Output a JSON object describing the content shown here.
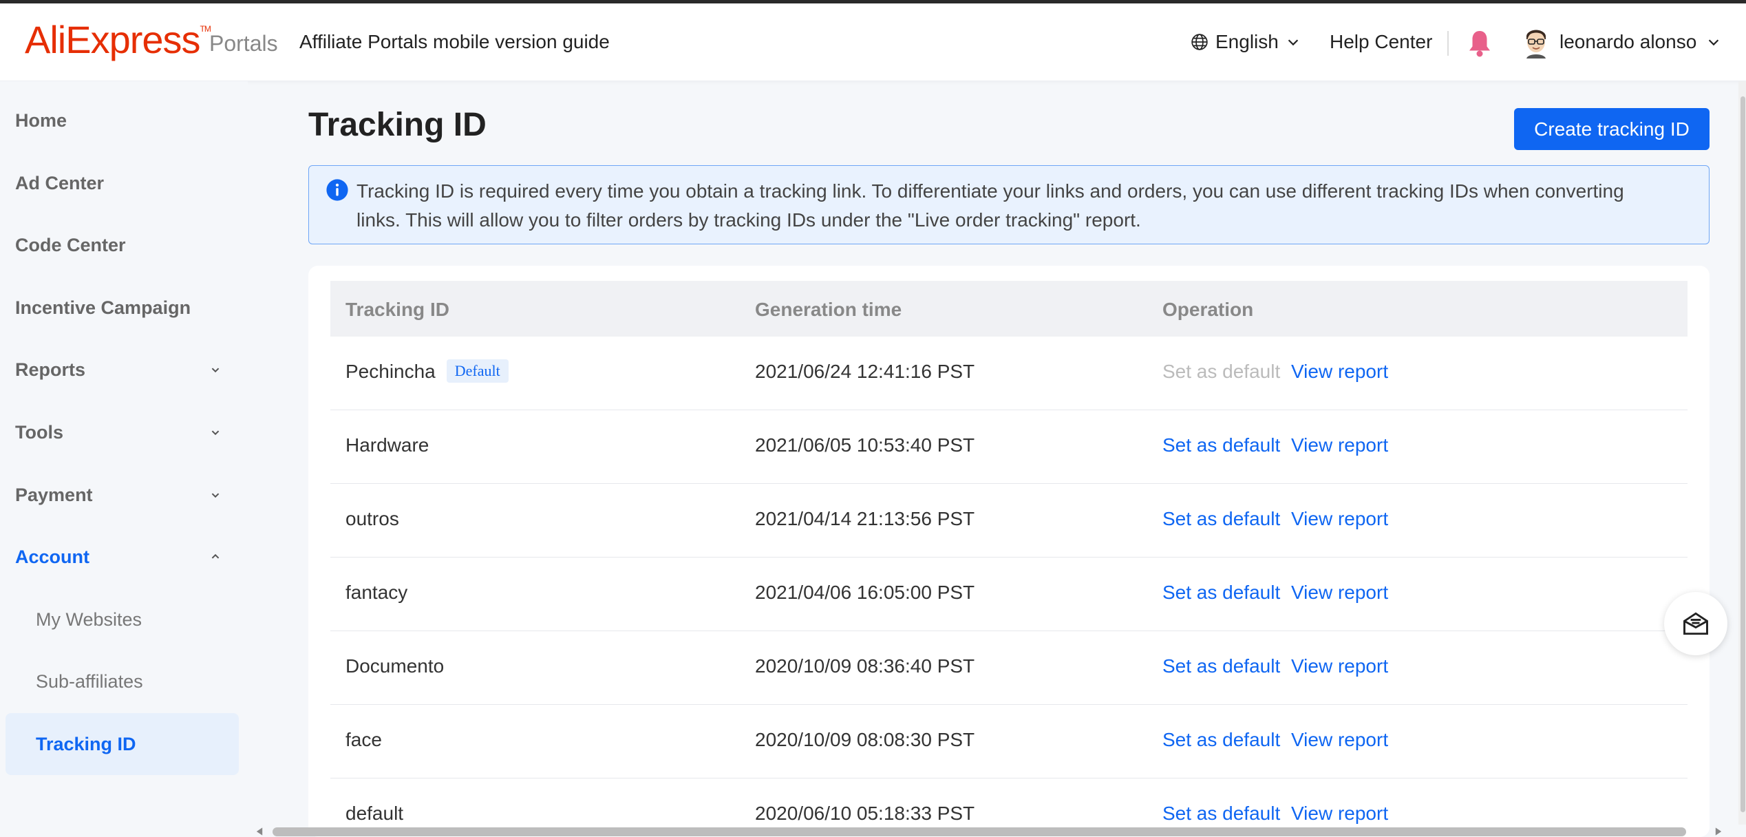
{
  "header": {
    "logo": "AliExpress",
    "logo_tm": "TM",
    "portals": "Portals",
    "guide_link": "Affiliate Portals mobile version guide",
    "language": "English",
    "help": "Help Center",
    "username": "leonardo alonso"
  },
  "sidebar": {
    "items": [
      {
        "label": "Home"
      },
      {
        "label": "Ad Center"
      },
      {
        "label": "Code Center"
      },
      {
        "label": "Incentive Campaign"
      },
      {
        "label": "Reports"
      },
      {
        "label": "Tools"
      },
      {
        "label": "Payment"
      },
      {
        "label": "Account"
      }
    ],
    "sub_items": [
      {
        "label": "My Websites"
      },
      {
        "label": "Sub-affiliates"
      },
      {
        "label": "Tracking ID"
      }
    ]
  },
  "main": {
    "title": "Tracking ID",
    "create_button": "Create tracking ID",
    "info": "Tracking ID is required every time you obtain a tracking link. To differentiate your links and orders, you can use different tracking IDs when converting links. This will allow you to filter orders by tracking IDs under the \"Live order tracking\" report."
  },
  "table": {
    "headers": {
      "id": "Tracking ID",
      "time": "Generation time",
      "op": "Operation"
    },
    "default_badge": "Default",
    "set_default": "Set as default",
    "view_report": "View report",
    "rows": [
      {
        "id": "Pechincha",
        "time": "2021/06/24 12:41:16 PST"
      },
      {
        "id": "Hardware",
        "time": "2021/06/05 10:53:40 PST"
      },
      {
        "id": "outros",
        "time": "2021/04/14 21:13:56 PST"
      },
      {
        "id": "fantacy",
        "time": "2021/04/06 16:05:00 PST"
      },
      {
        "id": "Documento",
        "time": "2020/10/09 08:36:40 PST"
      },
      {
        "id": "face",
        "time": "2020/10/09 08:08:30 PST"
      },
      {
        "id": "default",
        "time": "2020/06/10 05:18:33 PST"
      }
    ]
  },
  "colors": {
    "brand": "#e62e04",
    "accent": "#0f66f2"
  }
}
